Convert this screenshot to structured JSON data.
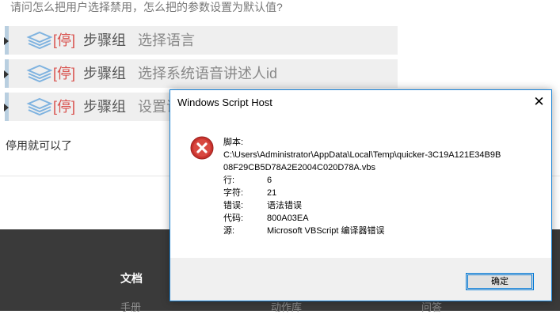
{
  "question": "请问怎么把用户选择禁用，怎么把的参数设置为默认值?",
  "steps": [
    {
      "stop": "[停]",
      "group": "步骤组",
      "desc": "选择语言"
    },
    {
      "stop": "[停]",
      "group": "步骤组",
      "desc": "选择系统语音讲述人id"
    },
    {
      "stop": "[停]",
      "group": "步骤组",
      "desc": "设置语"
    }
  ],
  "answer": "停用就可以了",
  "footer": {
    "heading": "文档",
    "links": [
      "手册",
      "动作库",
      "问答"
    ]
  },
  "dialog": {
    "title": "Windows Script Host",
    "close": "✕",
    "script_label": "脚本:",
    "script_path_line1": "C:\\Users\\Administrator\\AppData\\Local\\Temp\\quicker-3C19A121E34B9B",
    "script_path_line2": "08F29CB5D78A2E2004C020D78A.vbs",
    "rows": [
      {
        "label": "行:",
        "value": "6"
      },
      {
        "label": "字符:",
        "value": "21"
      },
      {
        "label": "错误:",
        "value": "语法错误"
      },
      {
        "label": "代码:",
        "value": "800A03EA"
      },
      {
        "label": "源:",
        "value": "Microsoft VBScript 编译器错误"
      }
    ],
    "ok_label": "确定"
  }
}
